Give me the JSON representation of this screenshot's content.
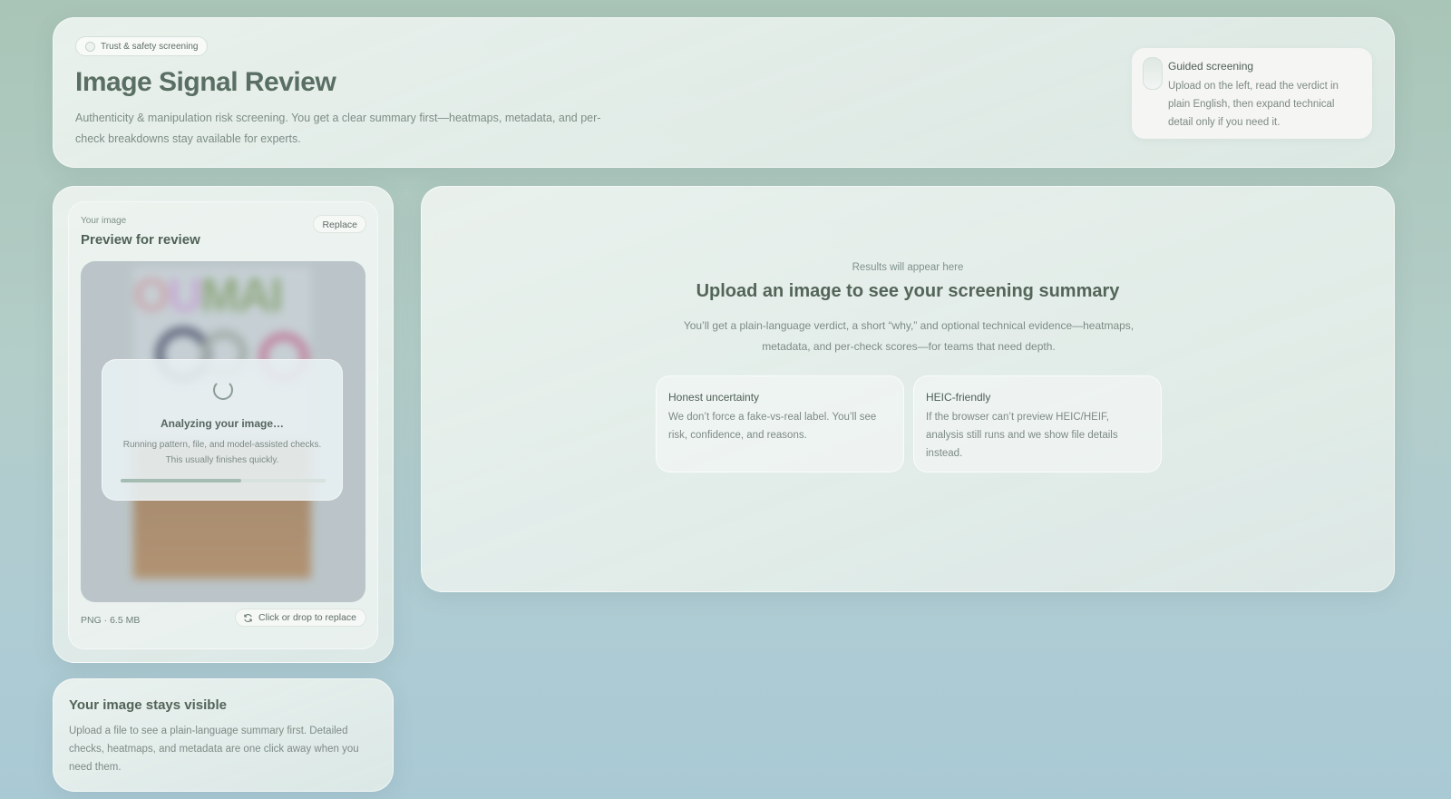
{
  "header": {
    "badge": "Trust & safety screening",
    "title": "Image Signal Review",
    "subtitle": "Authenticity & manipulation risk screening. You get a clear summary first—heatmaps, metadata, and per-check breakdowns stay available for experts.",
    "guide": {
      "title": "Guided screening",
      "text": "Upload on the left, read the verdict in plain English, then expand technical detail only if you need it."
    }
  },
  "upload": {
    "eyebrow": "Your image",
    "title": "Preview for review",
    "replace_label": "Replace",
    "preview_text": "OUMAI",
    "loading": {
      "title": "Analyzing your image…",
      "text": "Running pattern, file, and model-assisted checks. This usually finishes quickly.",
      "progress": 0.59
    },
    "file_meta": "PNG · 6.5 MB",
    "drop_label": "Click or drop to replace",
    "drop_icon": "refresh-icon"
  },
  "visibility": {
    "title": "Your image stays visible",
    "text": "Upload a file to see a plain-language summary first. Detailed checks, heatmaps, and metadata are one click away when you need them."
  },
  "results": {
    "eyebrow": "Results will appear here",
    "title": "Upload an image to see your screening summary",
    "text": "You’ll get a plain-language verdict, a short “why,” and optional technical evidence—heatmaps, metadata, and per-check scores—for teams that need depth.",
    "features": [
      {
        "title": "Honest uncertainty",
        "text": "We don’t force a fake-vs-real label. You’ll see risk, confidence, and reasons."
      },
      {
        "title": "HEIC-friendly",
        "text": "If the browser can’t preview HEIC/HEIF, analysis still runs and we show file details instead."
      }
    ]
  },
  "colors": {
    "accent": "#5a6f63",
    "muted_text": "#7d8b85",
    "progress_fill": "#a5bcb3"
  }
}
